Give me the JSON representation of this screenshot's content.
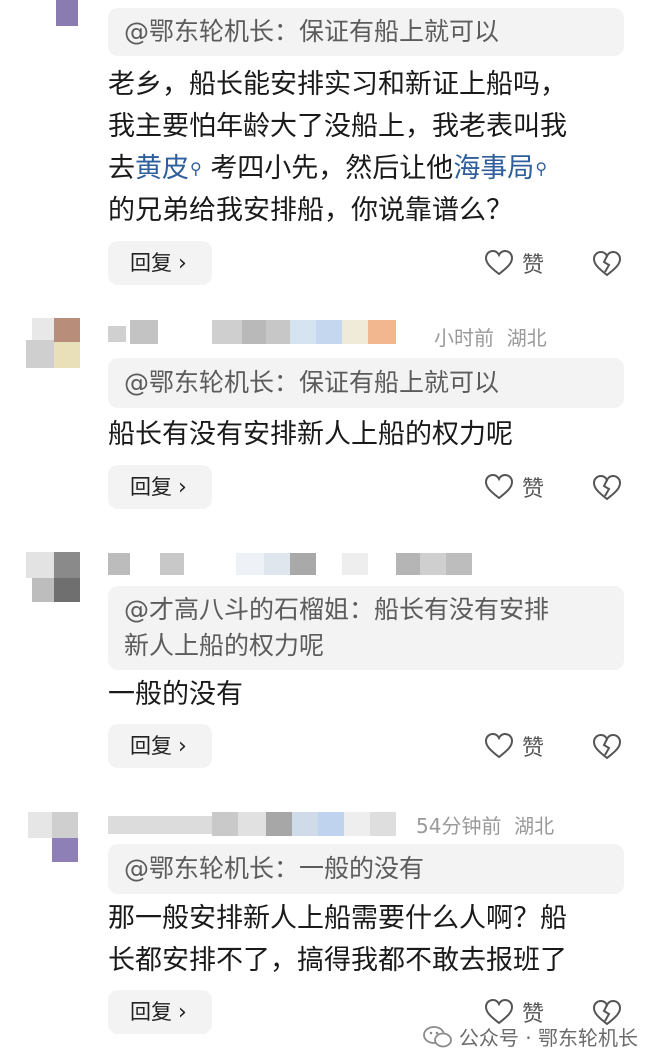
{
  "comments": [
    {
      "quote": "@鄂东轮机长：保证有船上就可以",
      "body_lines": [
        {
          "pre": "老乡，船长能安排实习和新证上船吗，"
        },
        {
          "pre": "我主要怕年龄大了没船上，我老表叫我"
        },
        {
          "pre": "去",
          "link1": "黄皮",
          "mid": "考四小先，然后让他",
          "link2": "海事局"
        },
        {
          "pre": "的兄弟给我安排船，你说靠谱么？"
        }
      ],
      "reply": "回复",
      "like": "赞"
    },
    {
      "meta_time": "小时前",
      "meta_loc": "湖北",
      "quote": "@鄂东轮机长：保证有船上就可以",
      "body_lines": [
        {
          "pre": "船长有没有安排新人上船的权力呢"
        }
      ],
      "reply": "回复",
      "like": "赞"
    },
    {
      "quote_lines": [
        "@才高八斗的石榴姐：船长有没有安排",
        "新人上船的权力呢"
      ],
      "body_lines": [
        {
          "pre": "一般的没有"
        }
      ],
      "reply": "回复",
      "like": "赞"
    },
    {
      "meta_time": "54分钟前",
      "meta_loc": "湖北",
      "quote": "@鄂东轮机长：一般的没有",
      "body_lines": [
        {
          "pre": "那一般安排新人上船需要什么人啊？船"
        },
        {
          "pre": "长都安排不了，搞得我都不敢去报班了"
        }
      ],
      "reply": "回复",
      "like": "赞"
    }
  ],
  "footer": {
    "label": "公众号 · 鄂东轮机长"
  },
  "icons": [
    "heart-outline-icon",
    "broken-heart-icon",
    "chevron-right-icon",
    "magnifier-icon",
    "wechat-icon"
  ],
  "colors": {
    "link": "#2f5e9c",
    "quote_bg": "#f3f3f3",
    "meta": "#9a9a9a"
  }
}
